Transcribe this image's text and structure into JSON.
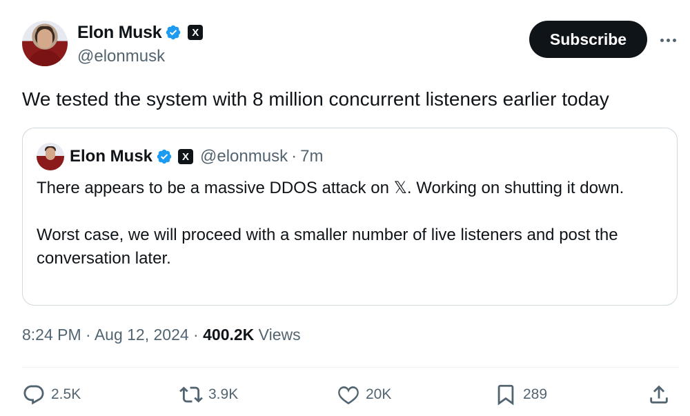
{
  "author": {
    "name": "Elon Musk",
    "handle": "@elonmusk",
    "x_badge": "X"
  },
  "subscribe_label": "Subscribe",
  "tweet_text": "We tested the system with 8 million concurrent listeners earlier today",
  "quote": {
    "name": "Elon Musk",
    "handle": "@elonmusk",
    "separator": "·",
    "time": "7m",
    "x_badge": "X",
    "body_line1": "There appears to be a massive DDOS attack on 𝕏. Working on shutting it down.",
    "body_line2": "Worst case, we will proceed with a smaller number of live listeners and post the conversation later."
  },
  "meta": {
    "time": "8:24 PM",
    "sep1": " · ",
    "date": "Aug 12, 2024",
    "sep2": " · ",
    "views_count": "400.2K",
    "views_label": " Views"
  },
  "actions": {
    "replies": "2.5K",
    "reposts": "3.9K",
    "likes": "20K",
    "bookmarks": "289"
  },
  "colors": {
    "verified": "#1d9bf0",
    "text": "#0f1419",
    "secondary": "#536471",
    "border": "#cfd9de"
  }
}
